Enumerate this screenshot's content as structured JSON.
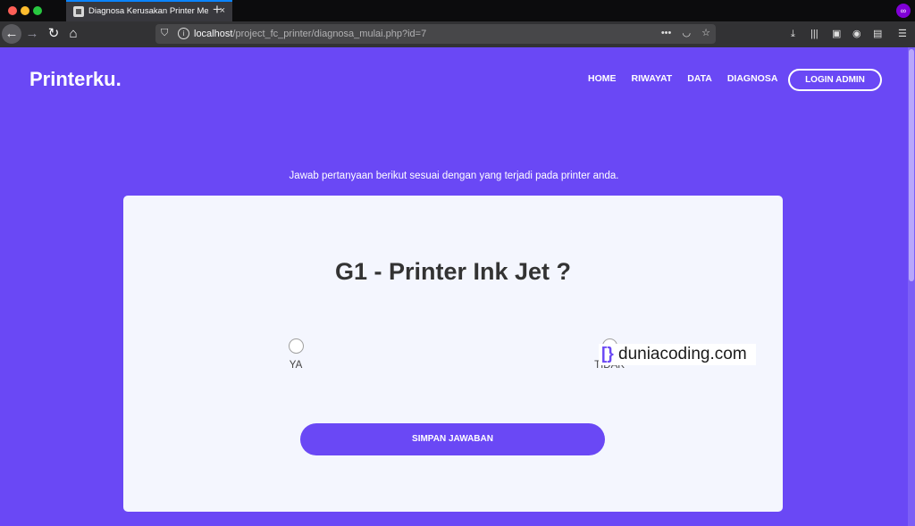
{
  "browser": {
    "tab_title": "Diagnosa Kerusakan Printer Me",
    "tab_close": "×",
    "new_tab": "+",
    "url_host": "localhost",
    "url_path": "/project_fc_printer/diagnosa_mulai.php?id=7",
    "icons": [
      "back-icon",
      "forward-icon",
      "reload-icon",
      "home-icon",
      "shield-icon",
      "info-icon",
      "more-icon",
      "pocket-icon",
      "bookmark-star-icon",
      "download-icon",
      "library-icon",
      "sidebar-icon",
      "account-icon",
      "extension-icon",
      "menu-icon",
      "private-mask-icon"
    ]
  },
  "header": {
    "brand": "Printerku.",
    "nav": [
      "HOME",
      "RIWAYAT",
      "DATA",
      "DIAGNOSA"
    ],
    "login_label": "LOGIN ADMIN"
  },
  "main": {
    "instruction": "Jawab pertanyaan berikut sesuai dengan yang terjadi pada printer anda.",
    "question": "G1 - Printer Ink Jet ?",
    "options": [
      "YA",
      "TIDAK"
    ],
    "submit_label": "SIMPAN JAWABAN"
  },
  "watermark": {
    "mark": "[}",
    "text": "duniacoding.com"
  },
  "colors": {
    "accent": "#6a48f5",
    "card": "#f4f6fe"
  }
}
